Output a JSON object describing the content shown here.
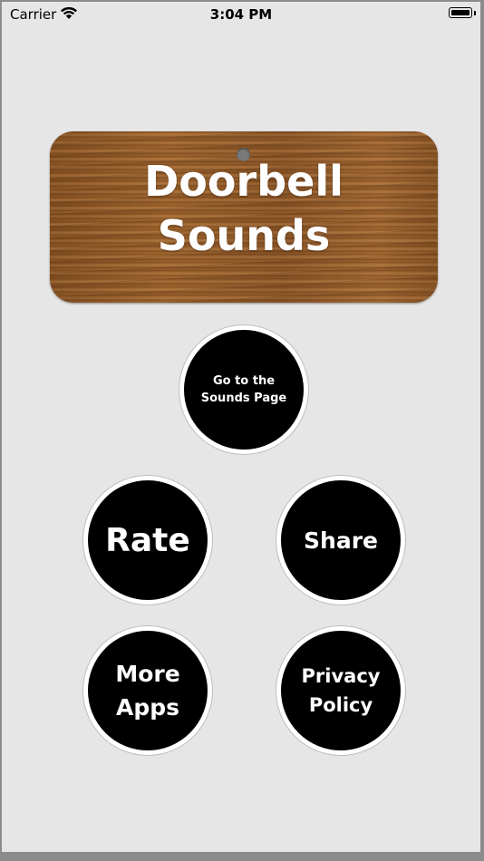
{
  "status_bar": {
    "carrier": "Carrier",
    "time": "3:04 PM",
    "icons": [
      "wifi-icon",
      "battery-icon"
    ]
  },
  "header": {
    "title": "Doorbell\nSounds"
  },
  "buttons": {
    "sounds_page": "Go to the\nSounds Page",
    "rate": "Rate",
    "share": "Share",
    "more_apps": "More\nApps",
    "privacy_policy": "Privacy\nPolicy"
  },
  "colors": {
    "background": "#e6e6e6",
    "button_fill": "#000000",
    "button_ring": "#ffffff",
    "wood": "#9a6130",
    "text_on_wood": "#ffffff"
  }
}
